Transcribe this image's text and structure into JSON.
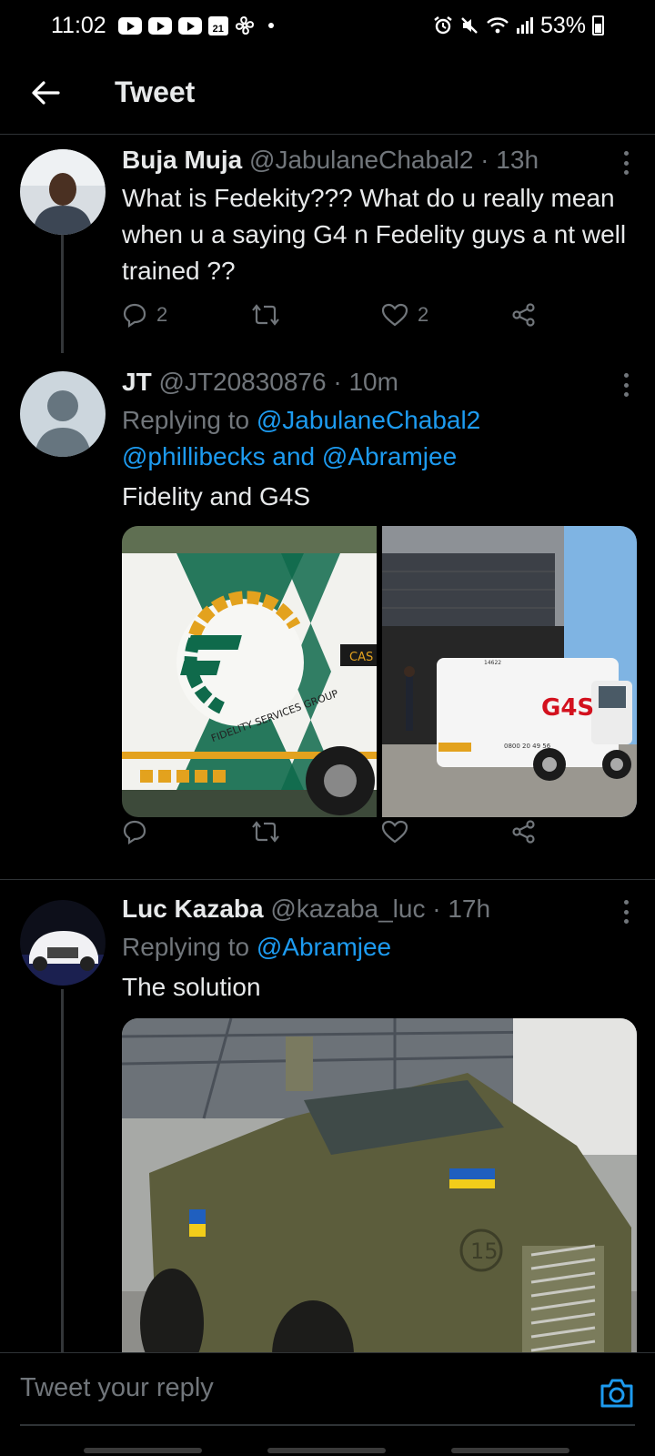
{
  "status_bar": {
    "time": "11:02",
    "calendar_day": "21",
    "battery": "53%",
    "icons": [
      "youtube-icon",
      "youtube-icon",
      "youtube-icon",
      "calendar-icon",
      "fan-icon",
      "alarm-icon",
      "mute-icon",
      "wifi-icon",
      "signal-icon",
      "battery-icon"
    ]
  },
  "header": {
    "title": "Tweet",
    "back_icon": "arrow-left-icon"
  },
  "tweets": [
    {
      "name": "Buja Muja",
      "handle": "@JabulaneChabal2",
      "sep": " · ",
      "time": "13h",
      "text": "What is Fedekity??? What do u really mean when u a saying G4 n Fedelity guys a nt well trained ??",
      "reply_count": "2",
      "retweet_count": "",
      "like_count": "2"
    },
    {
      "name": "JT",
      "handle": "@JT20830876",
      "sep": " · ",
      "time": "10m",
      "replying_prefix": "Replying to ",
      "replying_1": "@JabulaneChabal2",
      "replying_2": "@phillibecks",
      "replying_and": " and ",
      "replying_3": "@Abramjee",
      "text": "Fidelity and G4S",
      "media_1": {
        "logo_text": "FIDELITY SERVICES GROUP",
        "side_text": "CAS"
      },
      "media_2": {
        "logo_text": "G4S",
        "phone": "0800 20 49 56",
        "unit": "14622"
      }
    },
    {
      "name": "Luc Kazaba",
      "handle": "@kazaba_luc",
      "sep": " · ",
      "time": "17h",
      "replying_prefix": "Replying to ",
      "replying_1": "@Abramjee",
      "text": "The solution",
      "media": {
        "badge": "15"
      }
    }
  ],
  "reply_bar": {
    "placeholder": "Tweet your reply",
    "camera_icon": "camera-icon"
  },
  "colors": {
    "background": "#000000",
    "text": "#e7e9ea",
    "muted": "#71767b",
    "accent": "#1d9bf0",
    "divider": "#2f3336"
  }
}
